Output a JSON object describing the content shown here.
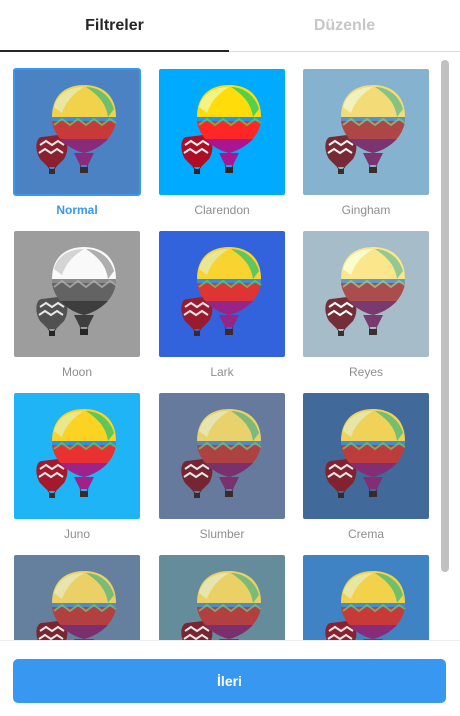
{
  "tabs": [
    {
      "label": "Filtreler",
      "active": true
    },
    {
      "label": "Düzenle",
      "active": false
    }
  ],
  "filters": [
    {
      "name": "Normal",
      "selected": true,
      "bg": "#4b82c4",
      "bw": false,
      "filter": "none"
    },
    {
      "name": "Clarendon",
      "selected": false,
      "bg": "#2e9fe0",
      "bw": false,
      "filter": "saturate(1.4) contrast(1.1)"
    },
    {
      "name": "Gingham",
      "selected": false,
      "bg": "#6faed3",
      "bw": false,
      "filter": "saturate(0.7) brightness(1.05)"
    },
    {
      "name": "Moon",
      "selected": false,
      "bg": "#9a9a9a",
      "bw": true,
      "filter": "grayscale(1) contrast(1.1)"
    },
    {
      "name": "Lark",
      "selected": false,
      "bg": "#3a63c8",
      "bw": false,
      "filter": "saturate(1.2)"
    },
    {
      "name": "Reyes",
      "selected": false,
      "bg": "#8cadbf",
      "bw": false,
      "filter": "saturate(0.6) brightness(1.1)"
    },
    {
      "name": "Juno",
      "selected": false,
      "bg": "#3aaee0",
      "bw": false,
      "filter": "saturate(1.3)"
    },
    {
      "name": "Slumber",
      "selected": false,
      "bg": "#5f7ba8",
      "bw": false,
      "filter": "saturate(0.75)"
    },
    {
      "name": "Crema",
      "selected": false,
      "bg": "#3d6aa0",
      "bw": false,
      "filter": "saturate(0.9)"
    },
    {
      "name": "",
      "selected": false,
      "bg": "#5f80a8",
      "bw": false,
      "filter": "saturate(0.8)"
    },
    {
      "name": "",
      "selected": false,
      "bg": "#5d8e9f",
      "bw": false,
      "filter": "saturate(0.8)"
    },
    {
      "name": "",
      "selected": false,
      "bg": "#3f83c4",
      "bw": false,
      "filter": "saturate(1)"
    }
  ],
  "footer": {
    "next_label": "İleri"
  },
  "colors": {
    "accent": "#3897f0",
    "tab_active": "#262626",
    "tab_inactive": "#c7c7c7",
    "label": "#8e8e8e"
  }
}
